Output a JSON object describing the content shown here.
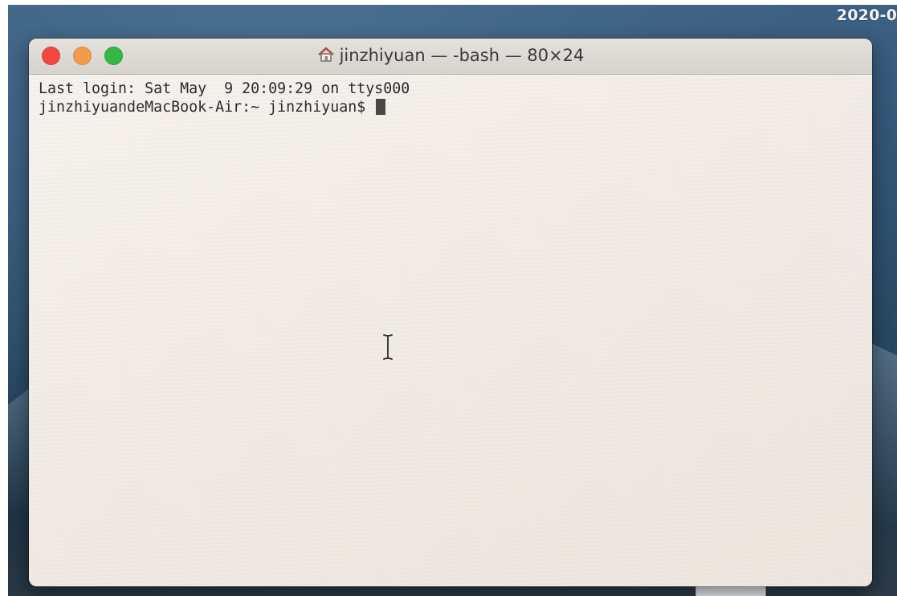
{
  "menubar": {
    "clock_text": "2020-0"
  },
  "window": {
    "title": "jinzhiyuan — -bash — 80×24",
    "title_icon": "home-icon",
    "traffic_lights": {
      "close_color": "#f2483f",
      "minimize_color": "#f39b4a",
      "maximize_color": "#33b845"
    }
  },
  "terminal": {
    "lines": [
      "Last login: Sat May  9 20:09:29 on ttys000",
      "jinzhiyuandeMacBook-Air:~ jinzhiyuan$ "
    ],
    "background_color": "#f3eee8",
    "text_color": "#2d2b2a"
  }
}
